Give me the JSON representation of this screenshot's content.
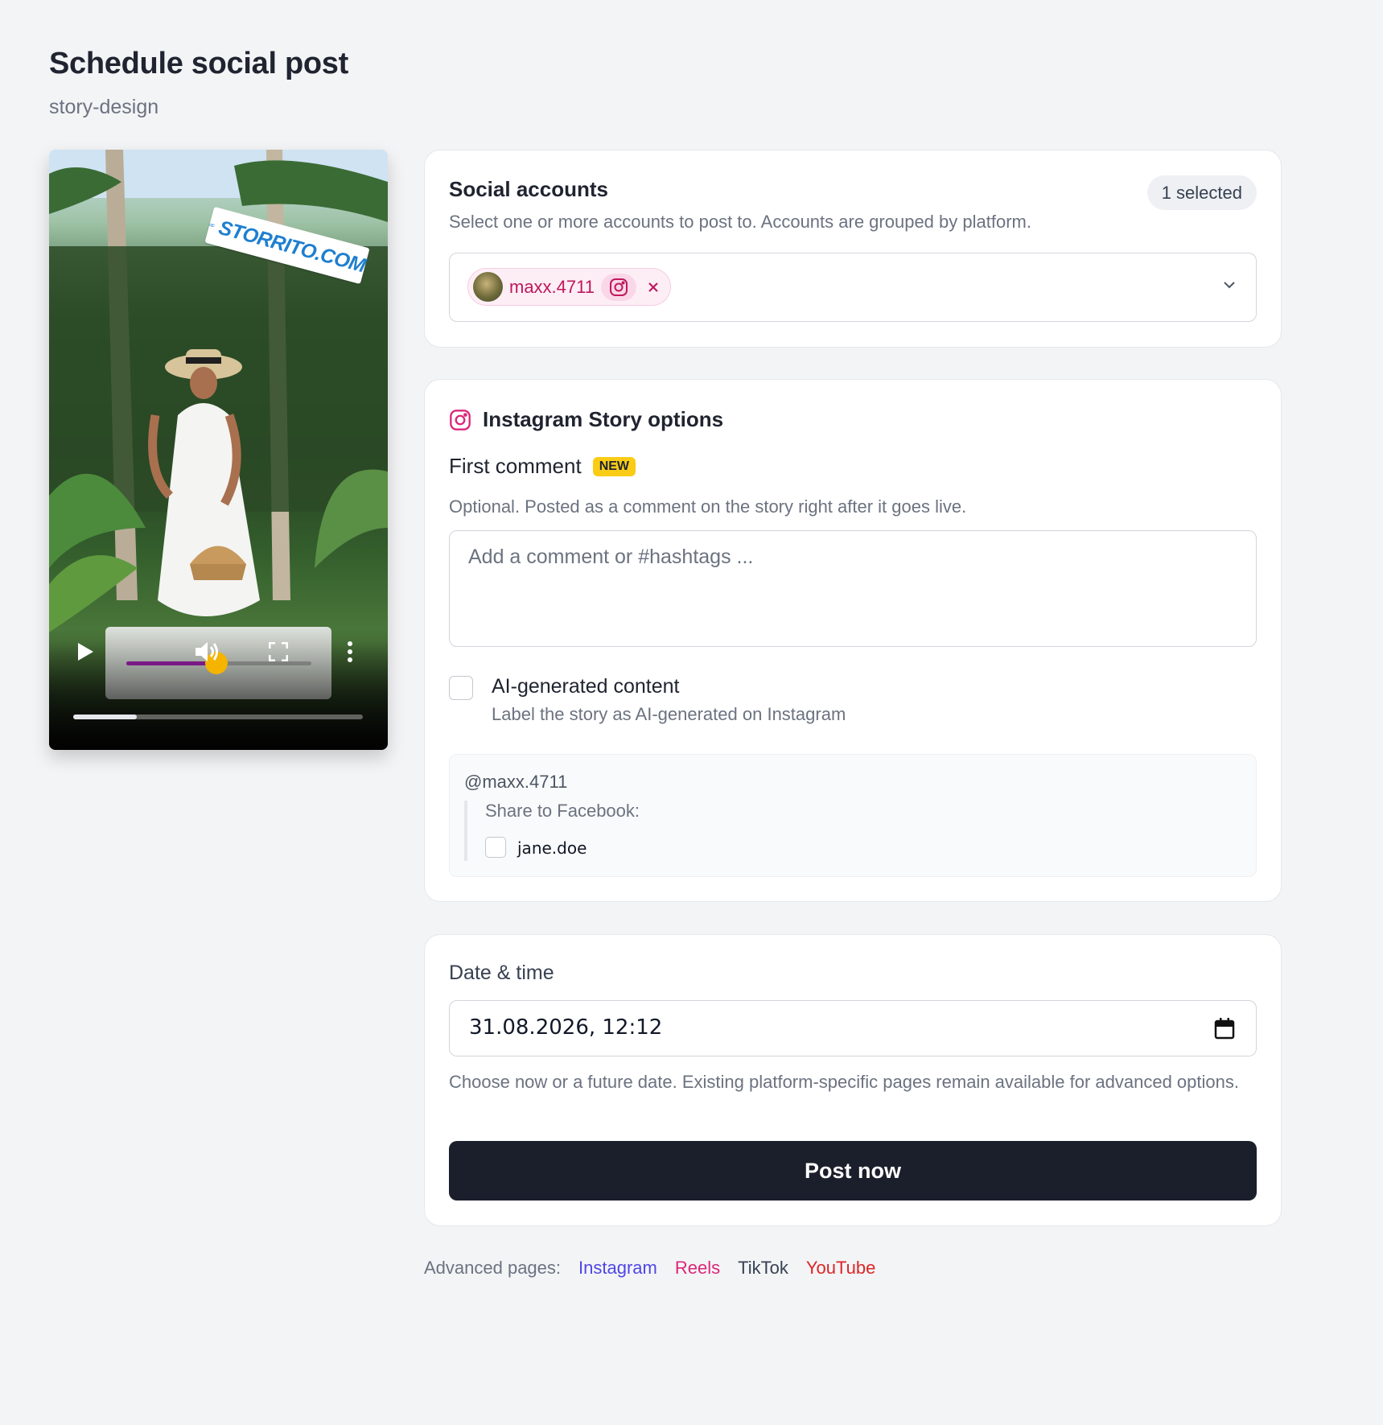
{
  "page": {
    "title": "Schedule social post",
    "subtitle": "story-design"
  },
  "preview": {
    "watermark": "STORRITO.COM",
    "volume_level": 0.45,
    "playback_progress": 0.22
  },
  "social_accounts": {
    "title": "Social accounts",
    "selected_badge": "1 selected",
    "description": "Select one or more accounts to post to. Accounts are grouped by platform.",
    "selected": [
      {
        "username": "maxx.4711",
        "platform_icon": "instagram-icon",
        "remove_icon": "close-icon"
      }
    ]
  },
  "instagram_story": {
    "title": "Instagram Story options",
    "first_comment": {
      "label": "First comment",
      "badge": "NEW",
      "help": "Optional. Posted as a comment on the story right after it goes live.",
      "placeholder": "Add a comment or #hashtags ...",
      "value": ""
    },
    "ai_content": {
      "label": "AI-generated content",
      "description": "Label the story as AI-generated on Instagram",
      "checked": false
    },
    "share": {
      "account": "@maxx.4711",
      "label": "Share to Facebook:",
      "pages": [
        {
          "name": "jane.doe",
          "checked": false
        }
      ]
    }
  },
  "schedule": {
    "label": "Date & time",
    "value": "31.08.2026, 12:12",
    "help": "Choose now or a future date. Existing platform-specific pages remain available for advanced options.",
    "submit": "Post now"
  },
  "advanced": {
    "label": "Advanced pages:",
    "links": [
      {
        "label": "Instagram",
        "color": "#4f46e5"
      },
      {
        "label": "Reels",
        "color": "#db2777"
      },
      {
        "label": "TikTok",
        "color": "#374151"
      },
      {
        "label": "YouTube",
        "color": "#dc2626"
      }
    ]
  },
  "colors": {
    "accent_pink": "#be185d",
    "primary_button": "#1b1f2c",
    "new_badge": "#facc15",
    "background": "#f3f4f6"
  }
}
